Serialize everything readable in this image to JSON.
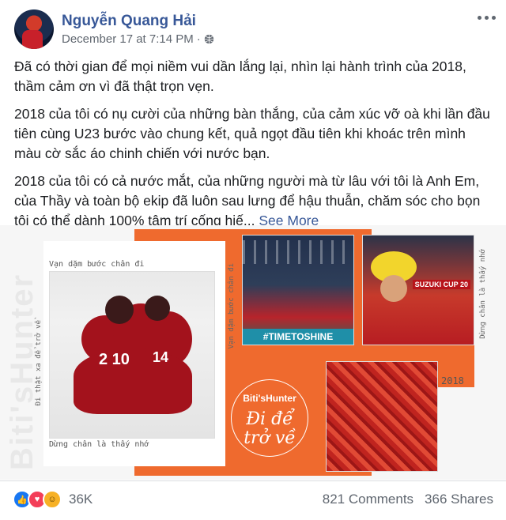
{
  "post": {
    "author": "Nguyễn Quang Hải",
    "timestamp": "December 17 at 7:14 PM",
    "separator": "·",
    "privacy_icon": "globe-icon",
    "paragraphs": [
      "Đã có thời gian để mọi niềm vui dần lắng lại, nhìn lại hành trình của 2018, thầm cảm ơn vì đã thật trọn vẹn.",
      "2018 của tôi có nụ cười của những bàn thắng, của cảm xúc vỡ oà khi lần đầu tiên cùng U23 bước vào chung kết, quả ngọt đầu tiên khi khoác trên mình màu cờ sắc áo chinh chiến với nước bạn.",
      "2018 của tôi có cả nước mắt, của những người mà từ lâu với tôi là Anh Em, của Thầy và toàn bộ ekip đã luôn sau lưng để hậu thuẫn, chăm sóc cho bọn tôi có thể dành 100% tâm trí cống hiế..."
    ],
    "see_more": "See More"
  },
  "image": {
    "watermark": "Biti'sHunter",
    "caption_top_left": "Vạn dặm bước chân đi",
    "caption_left_vertical": "Đi thật xa để trở về",
    "caption_bottom_left": "Dừng chân là thấy nhớ",
    "caption_mid_vertical": "Vạn dặm bước chân đi",
    "caption_right_vertical": "Dừng chân là thấy nhớ",
    "banner": "#TIMETOSHINE",
    "cup_text": "SUZUKI CUP 20",
    "jersey_1": "2 10",
    "jersey_2": "14",
    "logo_brand": "Biti'sHunter",
    "logo_script": "Đi để trở về",
    "year": "2018"
  },
  "footer": {
    "reaction_icons": [
      "like-icon",
      "love-icon",
      "haha-icon"
    ],
    "reaction_count": "36K",
    "comments": "821 Comments",
    "shares": "366 Shares"
  },
  "colors": {
    "link_blue": "#385898",
    "accent_orange": "#ef6a2e",
    "like_blue": "#1877f2",
    "love_red": "#f33e58",
    "haha_yellow": "#f7b125"
  }
}
